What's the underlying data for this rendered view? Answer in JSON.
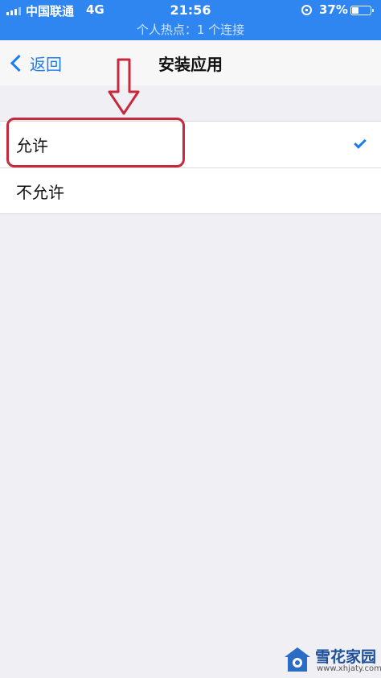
{
  "status_bar": {
    "carrier": "中国联通",
    "network": "4G",
    "time": "21:56",
    "battery": "37%",
    "battery_level": 0.37,
    "hotspot": "个人热点：1 个连接"
  },
  "nav": {
    "back_label": "返回",
    "title": "安装应用"
  },
  "options": [
    {
      "label": "允许",
      "selected": true
    },
    {
      "label": "不允许",
      "selected": false
    }
  ],
  "watermark": {
    "name": "雪花家园",
    "url": "www.xhjaty.com"
  },
  "colors": {
    "accent": "#1d7cf2",
    "status_bar_bg": "#2f86f0",
    "highlight": "#c8283c"
  }
}
